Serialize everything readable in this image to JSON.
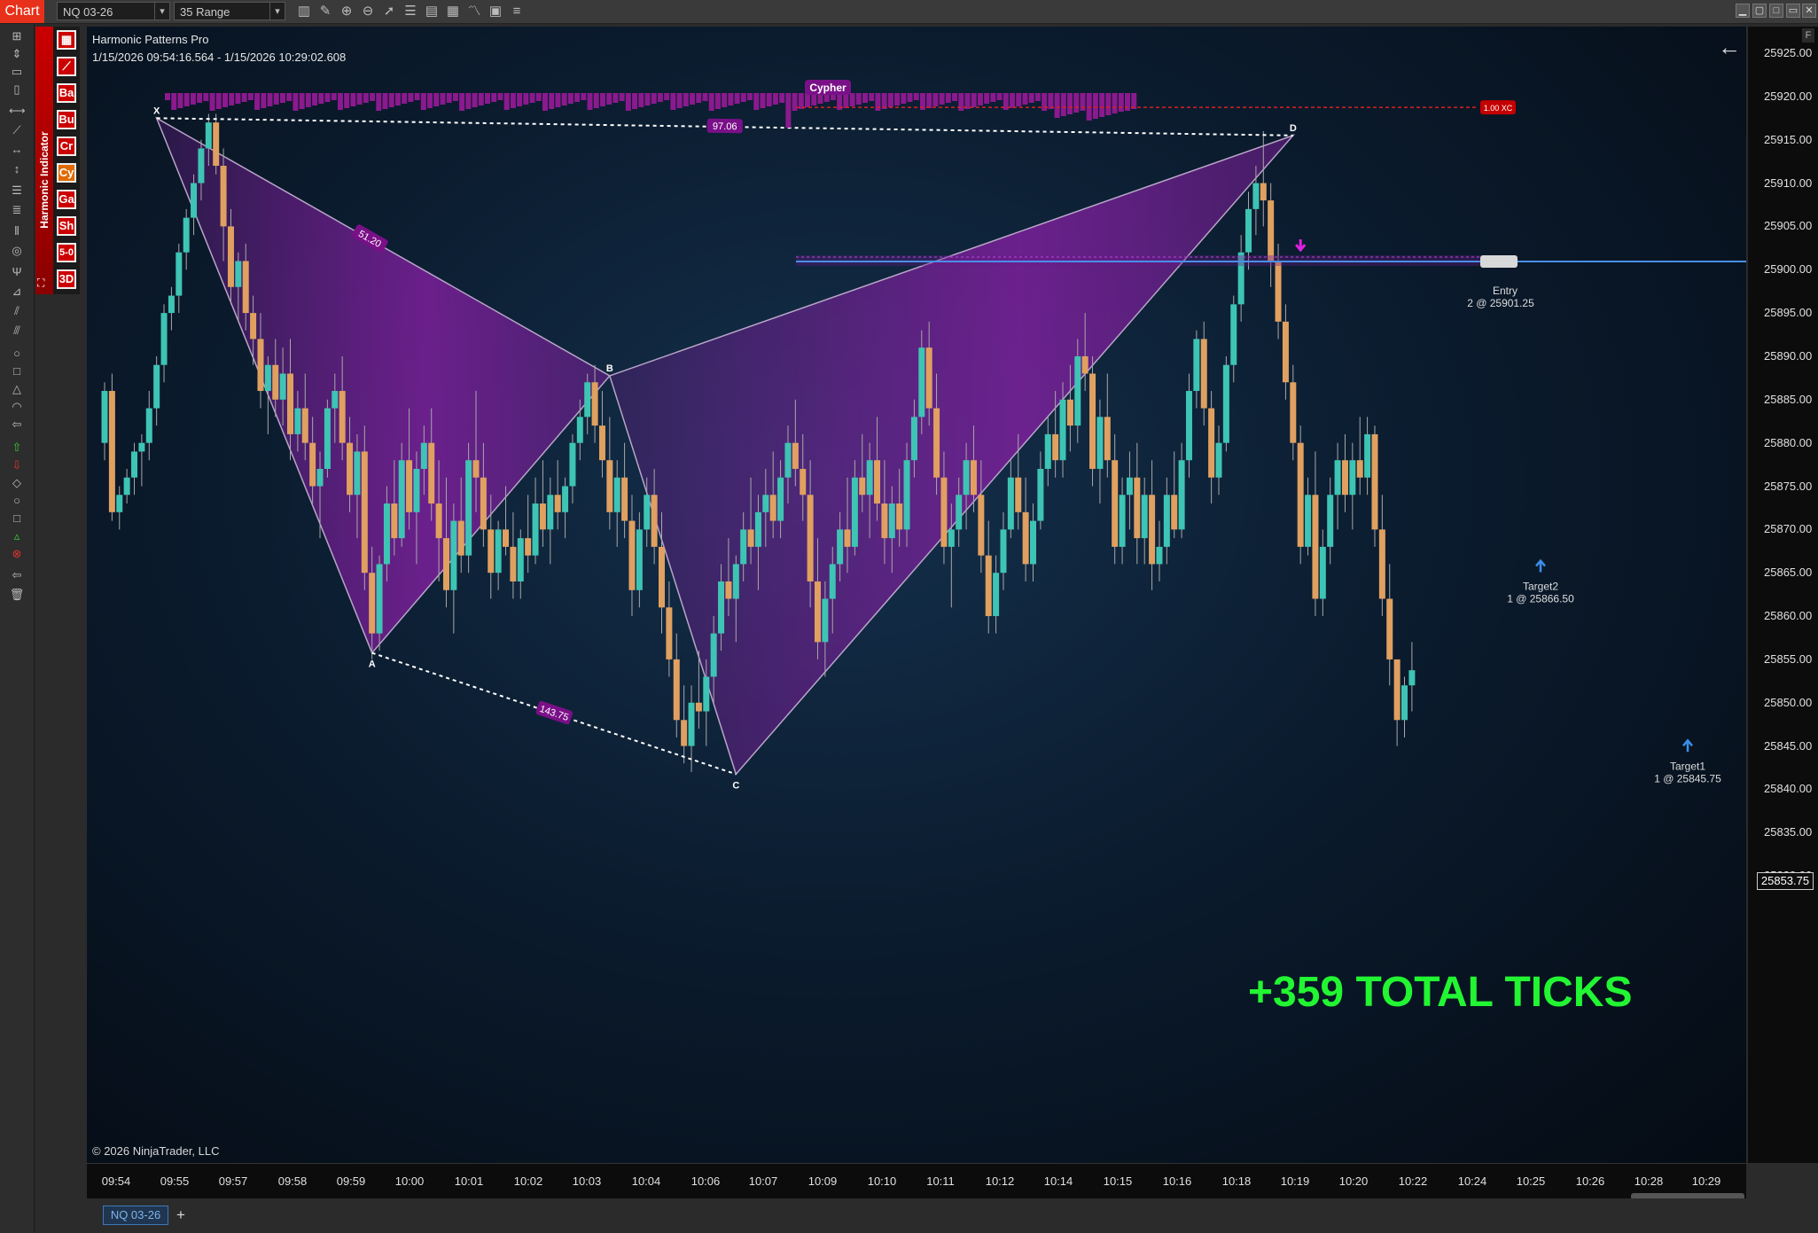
{
  "toolbar": {
    "chart_label": "Chart",
    "instrument": "NQ 03-26",
    "bar_type": "35 Range"
  },
  "indicator_panel": {
    "label": "Harmonic Indicator",
    "buttons": [
      "Ba",
      "Bu",
      "Cr",
      "Cy",
      "Ga",
      "Sh",
      "5-0",
      "3D"
    ]
  },
  "chart_header": {
    "title": "Harmonic Patterns Pro",
    "range": "1/15/2026 09:54:16.564 - 1/15/2026 10:29:02.608"
  },
  "copyright": "© 2026 NinjaTrader, LLC",
  "banner": "+359 TOTAL TICKS",
  "current_price": "25853.75",
  "tabs": [
    "NQ 03-26"
  ],
  "colors": {
    "up_candle": "#3ec4b4",
    "down_candle": "#e0a060",
    "pattern_fill": "#8a1fa8",
    "profit_text": "#22f532",
    "entry_line": "#4a8fe8",
    "window_accent": "#e8311a"
  },
  "chart_data": {
    "type": "candlestick",
    "title": "Harmonic Patterns Pro",
    "instrument": "NQ 03-26",
    "bar_type": "35 Range",
    "y_range": [
      25826,
      25929
    ],
    "y_ticks": [
      25925.0,
      25920.0,
      25915.0,
      25910.0,
      25905.0,
      25900.0,
      25895.0,
      25890.0,
      25885.0,
      25880.0,
      25875.0,
      25870.0,
      25865.0,
      25860.0,
      25855.0,
      25850.0,
      25845.0,
      25840.0,
      25835.0,
      25830.0
    ],
    "x_ticks": [
      "09:54",
      "09:55",
      "09:57",
      "09:58",
      "09:59",
      "10:00",
      "10:01",
      "10:02",
      "10:03",
      "10:04",
      "10:06",
      "10:07",
      "10:09",
      "10:10",
      "10:11",
      "10:12",
      "10:14",
      "10:15",
      "10:16",
      "10:18",
      "10:19",
      "10:20",
      "10:22",
      "10:24",
      "10:25",
      "10:26",
      "10:28",
      "10:29"
    ],
    "pattern": {
      "name": "Cypher",
      "points": [
        {
          "label": "X",
          "bar": 7,
          "price": 25917.5
        },
        {
          "label": "A",
          "bar": 36,
          "price": 25855.75
        },
        {
          "label": "B",
          "bar": 68,
          "price": 25887.75
        },
        {
          "label": "C",
          "bar": 85,
          "price": 25841.75
        },
        {
          "label": "D",
          "bar": 160,
          "price": 25915.5
        }
      ],
      "ratios": [
        {
          "label": "51.20",
          "segment": "XB"
        },
        {
          "label": "143.75",
          "segment": "AC"
        },
        {
          "label": "97.06",
          "segment": "XD"
        }
      ],
      "zone": {
        "label": "1.00 XC",
        "price": 25918.75
      }
    },
    "trades": [
      {
        "name": "Entry",
        "text": "2 @ 25901.25",
        "price": 25901.25
      },
      {
        "name": "Target2",
        "text": "1 @ 25866.50",
        "price": 25866.5
      },
      {
        "name": "Target1",
        "text": "1 @ 25845.75",
        "price": 25845.75
      }
    ],
    "candles": [
      [
        25880,
        25887,
        25878,
        25886
      ],
      [
        25886,
        25888,
        25871,
        25872
      ],
      [
        25872,
        25875,
        25870,
        25874
      ],
      [
        25874,
        25877,
        25873,
        25876
      ],
      [
        25876,
        25880,
        25874,
        25879
      ],
      [
        25879,
        25881,
        25875,
        25880
      ],
      [
        25880,
        25886,
        25878,
        25884
      ],
      [
        25884,
        25890,
        25882,
        25889
      ],
      [
        25889,
        25896,
        25887,
        25895
      ],
      [
        25895,
        25898,
        25893,
        25897
      ],
      [
        25897,
        25903,
        25895,
        25902
      ],
      [
        25902,
        25907,
        25900,
        25906
      ],
      [
        25906,
        25911,
        25904,
        25910
      ],
      [
        25910,
        25915,
        25908,
        25914
      ],
      [
        25914,
        25918,
        25912,
        25917
      ],
      [
        25917,
        25918,
        25911,
        25912
      ],
      [
        25912,
        25914,
        25901,
        25905
      ],
      [
        25905,
        25907,
        25896,
        25898
      ],
      [
        25898,
        25902,
        25894,
        25901
      ],
      [
        25901,
        25903,
        25893,
        25895
      ],
      [
        25895,
        25897,
        25889,
        25892
      ],
      [
        25892,
        25895,
        25884,
        25886
      ],
      [
        25886,
        25890,
        25881,
        25889
      ],
      [
        25889,
        25892,
        25883,
        25885
      ],
      [
        25885,
        25891,
        25882,
        25888
      ],
      [
        25888,
        25892,
        25878,
        25881
      ],
      [
        25881,
        25886,
        25879,
        25884
      ],
      [
        25884,
        25888,
        25878,
        25880
      ],
      [
        25880,
        25883,
        25873,
        25875
      ],
      [
        25875,
        25879,
        25869,
        25877
      ],
      [
        25877,
        25885,
        25876,
        25884
      ],
      [
        25884,
        25888,
        25880,
        25886
      ],
      [
        25886,
        25890,
        25878,
        25880
      ],
      [
        25880,
        25883,
        25872,
        25874
      ],
      [
        25874,
        25881,
        25869,
        25879
      ],
      [
        25879,
        25882,
        25863,
        25865
      ],
      [
        25865,
        25868,
        25855,
        25858
      ],
      [
        25858,
        25867,
        25856,
        25866
      ],
      [
        25866,
        25875,
        25864,
        25873
      ],
      [
        25873,
        25878,
        25867,
        25869
      ],
      [
        25869,
        25880,
        25868,
        25878
      ],
      [
        25878,
        25884,
        25870,
        25872
      ],
      [
        25872,
        25879,
        25866,
        25877
      ],
      [
        25877,
        25882,
        25874,
        25880
      ],
      [
        25880,
        25884,
        25871,
        25873
      ],
      [
        25873,
        25878,
        25864,
        25869
      ],
      [
        25869,
        25876,
        25861,
        25863
      ],
      [
        25863,
        25873,
        25858,
        25871
      ],
      [
        25871,
        25876,
        25865,
        25867
      ],
      [
        25867,
        25880,
        25865,
        25878
      ],
      [
        25878,
        25886,
        25872,
        25876
      ],
      [
        25876,
        25880,
        25868,
        25870
      ],
      [
        25870,
        25874,
        25862,
        25865
      ],
      [
        25865,
        25871,
        25863,
        25870
      ],
      [
        25870,
        25875,
        25867,
        25868
      ],
      [
        25868,
        25872,
        25862,
        25864
      ],
      [
        25864,
        25870,
        25862,
        25869
      ],
      [
        25869,
        25874,
        25865,
        25867
      ],
      [
        25867,
        25876,
        25866,
        25873
      ],
      [
        25873,
        25878,
        25868,
        25870
      ],
      [
        25870,
        25876,
        25866,
        25874
      ],
      [
        25874,
        25878,
        25870,
        25872
      ],
      [
        25872,
        25876,
        25869,
        25875
      ],
      [
        25875,
        25881,
        25873,
        25880
      ],
      [
        25880,
        25885,
        25878,
        25883
      ],
      [
        25883,
        25888,
        25881,
        25887
      ],
      [
        25887,
        25889,
        25880,
        25882
      ],
      [
        25882,
        25886,
        25876,
        25878
      ],
      [
        25878,
        25883,
        25870,
        25872
      ],
      [
        25872,
        25878,
        25868,
        25876
      ],
      [
        25876,
        25880,
        25869,
        25871
      ],
      [
        25871,
        25874,
        25860,
        25863
      ],
      [
        25863,
        25872,
        25861,
        25870
      ],
      [
        25870,
        25876,
        25868,
        25874
      ],
      [
        25874,
        25877,
        25866,
        25868
      ],
      [
        25868,
        25872,
        25858,
        25861
      ],
      [
        25861,
        25864,
        25853,
        25855
      ],
      [
        25855,
        25858,
        25846,
        25848
      ],
      [
        25848,
        25852,
        25843,
        25845
      ],
      [
        25845,
        25852,
        25842,
        25850
      ],
      [
        25850,
        25856,
        25847,
        25849
      ],
      [
        25849,
        25855,
        25845,
        25853
      ],
      [
        25853,
        25860,
        25850,
        25858
      ],
      [
        25858,
        25866,
        25856,
        25864
      ],
      [
        25864,
        25869,
        25860,
        25862
      ],
      [
        25862,
        25867,
        25857,
        25866
      ],
      [
        25866,
        25872,
        25864,
        25870
      ],
      [
        25870,
        25876,
        25866,
        25868
      ],
      [
        25868,
        25874,
        25863,
        25872
      ],
      [
        25872,
        25877,
        25868,
        25874
      ],
      [
        25874,
        25879,
        25869,
        25871
      ],
      [
        25871,
        25878,
        25869,
        25876
      ],
      [
        25876,
        25882,
        25873,
        25880
      ],
      [
        25880,
        25885,
        25875,
        25877
      ],
      [
        25877,
        25881,
        25871,
        25874
      ],
      [
        25874,
        25878,
        25861,
        25864
      ],
      [
        25864,
        25869,
        25855,
        25857
      ],
      [
        25857,
        25864,
        25853,
        25862
      ],
      [
        25862,
        25868,
        25858,
        25866
      ],
      [
        25866,
        25872,
        25864,
        25870
      ],
      [
        25870,
        25876,
        25865,
        25868
      ],
      [
        25868,
        25878,
        25867,
        25876
      ],
      [
        25876,
        25881,
        25872,
        25874
      ],
      [
        25874,
        25880,
        25869,
        25878
      ],
      [
        25878,
        25883,
        25871,
        25873
      ],
      [
        25873,
        25878,
        25866,
        25869
      ],
      [
        25869,
        25875,
        25865,
        25873
      ],
      [
        25873,
        25877,
        25868,
        25870
      ],
      [
        25870,
        25880,
        25868,
        25878
      ],
      [
        25878,
        25885,
        25876,
        25883
      ],
      [
        25883,
        25893,
        25881,
        25891
      ],
      [
        25891,
        25894,
        25882,
        25884
      ],
      [
        25884,
        25888,
        25874,
        25876
      ],
      [
        25876,
        25879,
        25866,
        25868
      ],
      [
        25868,
        25873,
        25861,
        25870
      ],
      [
        25870,
        25876,
        25868,
        25874
      ],
      [
        25874,
        25880,
        25870,
        25878
      ],
      [
        25878,
        25882,
        25872,
        25874
      ],
      [
        25874,
        25878,
        25865,
        25867
      ],
      [
        25867,
        25871,
        25858,
        25860
      ],
      [
        25860,
        25867,
        25858,
        25865
      ],
      [
        25865,
        25872,
        25863,
        25870
      ],
      [
        25870,
        25878,
        25869,
        25876
      ],
      [
        25876,
        25881,
        25870,
        25872
      ],
      [
        25872,
        25876,
        25864,
        25866
      ],
      [
        25866,
        25873,
        25864,
        25871
      ],
      [
        25871,
        25879,
        25870,
        25877
      ],
      [
        25877,
        25883,
        25875,
        25881
      ],
      [
        25881,
        25886,
        25876,
        25878
      ],
      [
        25878,
        25887,
        25876,
        25885
      ],
      [
        25885,
        25889,
        25879,
        25882
      ],
      [
        25882,
        25892,
        25880,
        25890
      ],
      [
        25890,
        25895,
        25886,
        25888
      ],
      [
        25888,
        25890,
        25875,
        25877
      ],
      [
        25877,
        25885,
        25873,
        25883
      ],
      [
        25883,
        25888,
        25876,
        25878
      ],
      [
        25878,
        25881,
        25866,
        25868
      ],
      [
        25868,
        25876,
        25866,
        25874
      ],
      [
        25874,
        25879,
        25870,
        25876
      ],
      [
        25876,
        25880,
        25866,
        25869
      ],
      [
        25869,
        25876,
        25866,
        25874
      ],
      [
        25874,
        25878,
        25863,
        25866
      ],
      [
        25866,
        25871,
        25864,
        25868
      ],
      [
        25868,
        25876,
        25866,
        25874
      ],
      [
        25874,
        25879,
        25869,
        25870
      ],
      [
        25870,
        25880,
        25869,
        25878
      ],
      [
        25878,
        25888,
        25876,
        25886
      ],
      [
        25886,
        25893,
        25884,
        25892
      ],
      [
        25892,
        25894,
        25882,
        25884
      ],
      [
        25884,
        25886,
        25873,
        25876
      ],
      [
        25876,
        25882,
        25874,
        25880
      ],
      [
        25880,
        25890,
        25879,
        25889
      ],
      [
        25889,
        25897,
        25887,
        25896
      ],
      [
        25896,
        25904,
        25894,
        25902
      ],
      [
        25902,
        25909,
        25900,
        25907
      ],
      [
        25907,
        25912,
        25904,
        25910
      ],
      [
        25910,
        25916,
        25905,
        25908
      ],
      [
        25908,
        25910,
        25898,
        25901
      ],
      [
        25901,
        25903,
        25892,
        25894
      ],
      [
        25894,
        25896,
        25885,
        25887
      ],
      [
        25887,
        25889,
        25878,
        25880
      ],
      [
        25880,
        25882,
        25866,
        25868
      ],
      [
        25868,
        25876,
        25867,
        25874
      ],
      [
        25874,
        25879,
        25860,
        25862
      ],
      [
        25862,
        25870,
        25860,
        25868
      ],
      [
        25868,
        25876,
        25866,
        25874
      ],
      [
        25874,
        25880,
        25870,
        25878
      ],
      [
        25878,
        25881,
        25872,
        25874
      ],
      [
        25874,
        25880,
        25870,
        25878
      ],
      [
        25878,
        25883,
        25874,
        25876
      ],
      [
        25876,
        25883,
        25874,
        25881
      ],
      [
        25881,
        25882,
        25868,
        25870
      ],
      [
        25870,
        25874,
        25860,
        25862
      ],
      [
        25862,
        25866,
        25852,
        25855
      ],
      [
        25855,
        25850,
        25845,
        25848
      ],
      [
        25848,
        25853,
        25846,
        25852
      ],
      [
        25852,
        25857,
        25849,
        25853.75
      ]
    ]
  }
}
